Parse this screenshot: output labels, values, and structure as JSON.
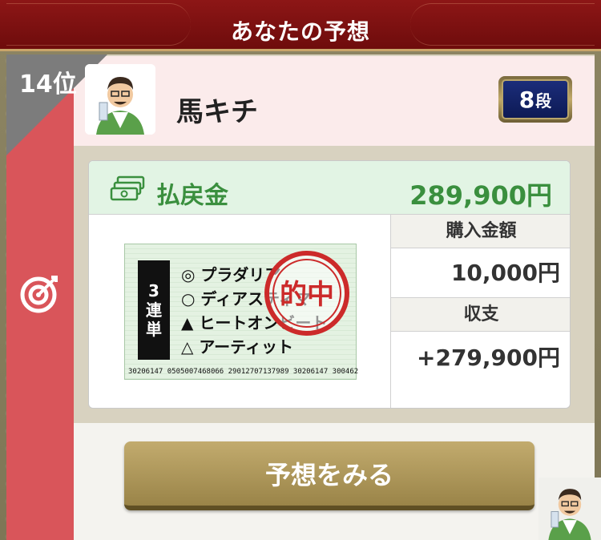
{
  "header": {
    "title": "あなたの予想"
  },
  "rank": {
    "label": "14位"
  },
  "user": {
    "name": "馬キチ",
    "dan_number": "8",
    "dan_unit": "段"
  },
  "payout": {
    "label": "払戻金",
    "value": "289,900円"
  },
  "ticket": {
    "type_chars": [
      "3",
      "連",
      "単"
    ],
    "horses": [
      "◎ プラダリア",
      "○ ディアスティマ",
      "▲ ヒートオンビート",
      "△ アーティット"
    ],
    "serial": "30206147  0505007468066 29012707137989 30206147 300462",
    "stamp_text": "的中"
  },
  "stats": {
    "purchase_label": "購入金額",
    "purchase_value": "10,000円",
    "balance_label": "収支",
    "balance_value": "+279,900円"
  },
  "button": {
    "label": "予想をみる"
  },
  "colors": {
    "header_red": "#8d1616",
    "band_red": "#d9555a",
    "payout_green": "#3a8f3e",
    "button_gold": "#b09a5c",
    "badge_navy": "#1b2d7a"
  },
  "icons": {
    "money": "money-stack-icon",
    "target": "target-icon",
    "avatar": "avatar-illustration"
  }
}
